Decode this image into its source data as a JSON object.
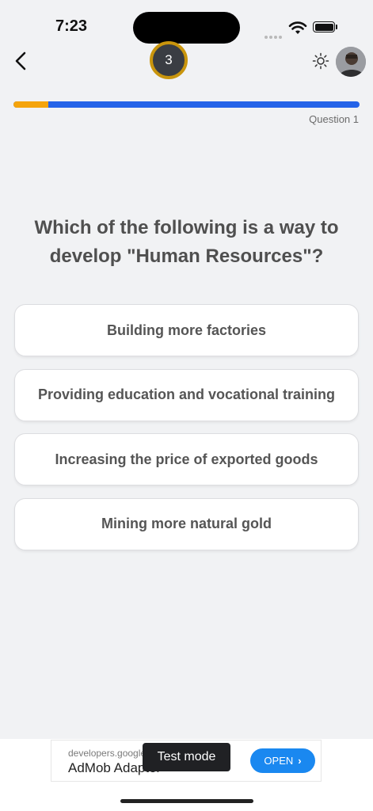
{
  "status_bar": {
    "time": "7:23"
  },
  "header": {
    "question_counter": "3"
  },
  "progress": {
    "fraction": 0.1,
    "label": "Question 1"
  },
  "question": {
    "text": "Which of the following is a way to develop \"Human Resources\"?"
  },
  "answers": [
    {
      "label": "Building more factories"
    },
    {
      "label": "Providing education and vocational training"
    },
    {
      "label": "Increasing the price of exported goods"
    },
    {
      "label": "Mining more natural gold"
    }
  ],
  "ad": {
    "domain": "developers.google.com",
    "title": "AdMob Adapter",
    "cta": "OPEN",
    "test_mode": "Test mode"
  },
  "colors": {
    "progress_done": "#f5a40c",
    "progress_track": "#2563e8",
    "counter_ring": "#c9950d",
    "cta": "#1a88f0"
  }
}
